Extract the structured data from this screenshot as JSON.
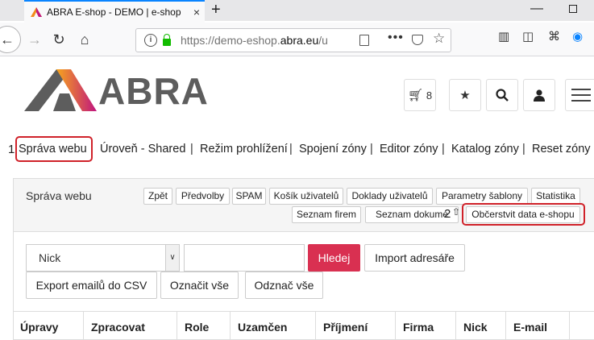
{
  "browser": {
    "tab_title": "ABRA E-shop - DEMO | e-shop",
    "url_prefix": "https://demo-eshop.",
    "url_domain": "abra.eu",
    "url_suffix": "/u",
    "tab_close": "×",
    "new_tab": "+",
    "minimize": "—"
  },
  "header": {
    "logo_text": "ABRA",
    "cart_count": "8"
  },
  "top_menu": [
    "Správa webu",
    "Úroveň - Shared",
    "Režim prohlížení",
    "Spojení zóny",
    "Editor zóny",
    "Katalog zóny",
    "Reset zóny"
  ],
  "menu_separator": "|",
  "annotations": {
    "first": "1",
    "second": "2"
  },
  "panel": {
    "title": "Správa webu",
    "buttons_row1": [
      "Zpět",
      "Předvolby",
      "SPAM",
      "Košík uživatelů",
      "Doklady uživatelů",
      "Parametry šablony",
      "Statistika"
    ],
    "buttons_row2": [
      "Seznam firem",
      "Seznam dokume",
      "Občerstvit data e-shopu"
    ]
  },
  "search": {
    "select_value": "Nick",
    "search_button": "Hledej",
    "import_button": "Import adresáře",
    "export_button": "Export emailů do CSV",
    "mark_all": "Označit vše",
    "unmark_all": "Odznač vše"
  },
  "table": {
    "columns": [
      "Úpravy",
      "Zpracovat",
      "Role",
      "Uzamčen",
      "Příjmení",
      "Firma",
      "Nick",
      "E-mail"
    ]
  }
}
